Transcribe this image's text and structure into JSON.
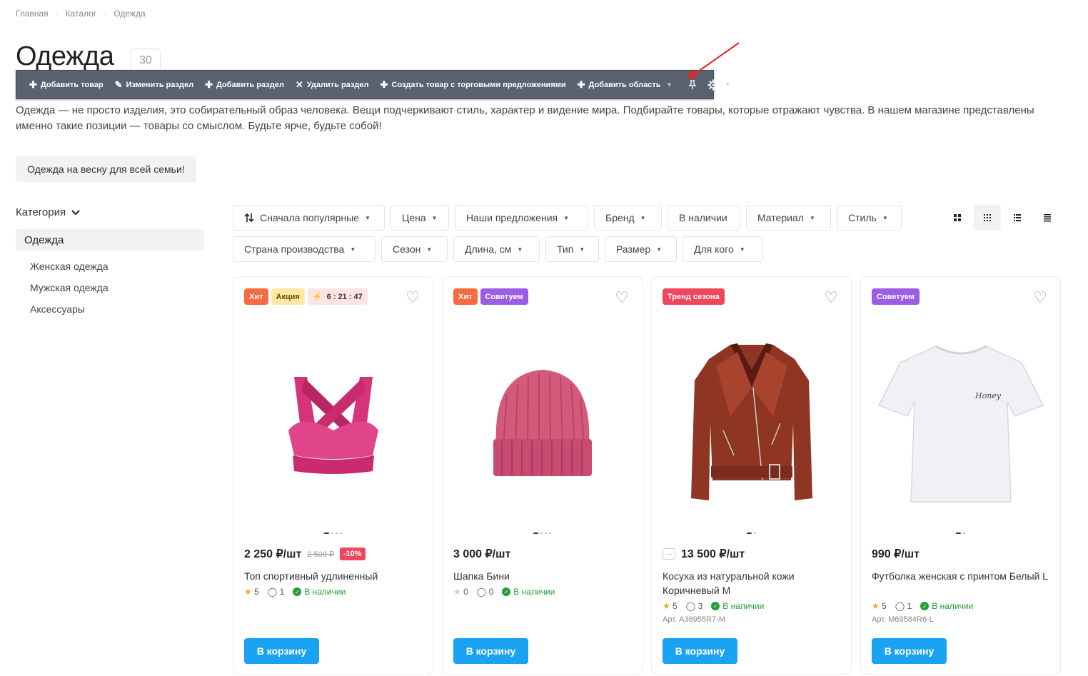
{
  "breadcrumbs": [
    "Главная",
    "Каталог",
    "Одежда"
  ],
  "breadcrumb_sep": "·",
  "page": {
    "title": "Одежда",
    "count": "30"
  },
  "toolbar": {
    "items": [
      "Добавить товар",
      "Изменить раздел",
      "Добавить раздел",
      "Удалить раздел",
      "Создать товар с торговыми предложениями",
      "Добавить область"
    ]
  },
  "description": "Одежда — не просто изделия, это собирательный образ человека. Вещи подчеркивают стиль, характер и видение мира. Подбирайте товары, которые отражают чувства. В нашем магазине представлены именно такие позиции — товары со смыслом. Будьте ярче, будьте собой!",
  "promo_tag": "Одежда на весну для всей семьи!",
  "sidebar": {
    "heading": "Категория",
    "active": "Одежда",
    "items": [
      "Женская одежда",
      "Мужская одежда",
      "Аксессуары"
    ]
  },
  "filters": {
    "sort": "Сначала популярные",
    "row1": [
      "Цена",
      "Наши предложения",
      "Бренд",
      "В наличии",
      "Материал",
      "Стиль"
    ],
    "row2": [
      "Страна производства",
      "Сезон",
      "Длина, см",
      "Тип",
      "Размер",
      "Для кого"
    ]
  },
  "colors": {
    "hit": "#f76b43",
    "sale": "#fde9a6",
    "timer_bg": "#fde3e3",
    "advise": "#9b5de5",
    "trend": "#f0465c",
    "cart": "#1aa3f2",
    "in_stock": "#21a038",
    "toolbar": "#5a6171"
  },
  "products": [
    {
      "badges": [
        "Хит",
        "Акция"
      ],
      "timer": "6 : 21 : 47",
      "price": "2 250 ₽/шт",
      "old_price": "2 500 ₽",
      "discount": "-10%",
      "name": "Топ спортивный удлиненный",
      "rating": "5",
      "reviews": "1",
      "stock": "В наличии",
      "cart": "В корзину"
    },
    {
      "badges": [
        "Хит",
        "Советуем"
      ],
      "price": "3 000 ₽/шт",
      "name": "Шапка Бини",
      "rating": "0",
      "reviews": "0",
      "stock": "В наличии",
      "cart": "В корзину"
    },
    {
      "badges": [
        "Тренд сезона"
      ],
      "more": "···",
      "price": "13 500 ₽/шт",
      "name": "Косуха из натуральной кожи Коричневый M",
      "rating": "5",
      "reviews": "3",
      "stock": "В наличии",
      "article": "Арт. A36955R7-M",
      "cart": "В корзину"
    },
    {
      "badges": [
        "Советуем"
      ],
      "price": "990 ₽/шт",
      "name": "Футболка женская с принтом Белый L",
      "rating": "5",
      "reviews": "1",
      "stock": "В наличии",
      "article": "Арт. M69584R6-L",
      "print_text": "Honey",
      "cart": "В корзину"
    }
  ]
}
